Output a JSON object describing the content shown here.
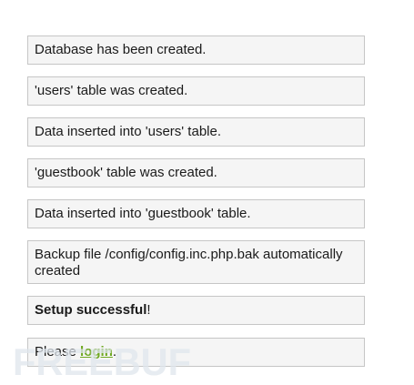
{
  "messages": {
    "db_created": "Database has been created.",
    "users_table_created": "'users' table was created.",
    "users_data_inserted": "Data inserted into 'users' table.",
    "guestbook_table_created": "'guestbook' table was created.",
    "guestbook_data_inserted": "Data inserted into 'guestbook' table.",
    "backup_created": "Backup file /config/config.inc.php.bak automatically created",
    "setup_bold": "Setup successful",
    "setup_suffix": "!",
    "login_prefix": "Please ",
    "login_link": "login",
    "login_suffix": "."
  },
  "watermark": {
    "text": "FREEBUF",
    "color": "#dfe6ec"
  }
}
